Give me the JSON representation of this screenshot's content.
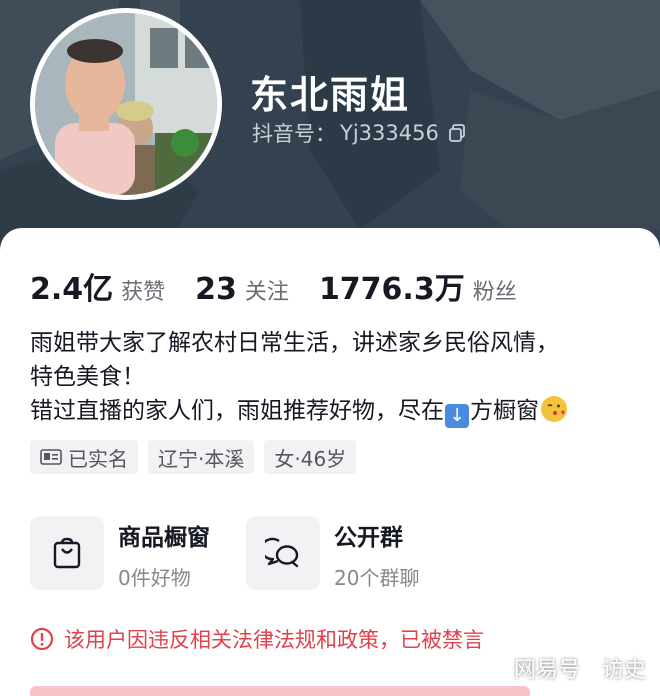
{
  "profile": {
    "nickname": "东北雨姐",
    "id_label": "抖音号：",
    "id_value": "Yj333456"
  },
  "stats": [
    {
      "value": "2.4亿",
      "label": "获赞"
    },
    {
      "value": "23",
      "label": "关注"
    },
    {
      "value": "1776.3万",
      "label": "粉丝"
    }
  ],
  "bio": {
    "line1": "雨姐带大家了解农村日常生活，讲述家乡民俗风情，",
    "line2": "特色美食！",
    "line3_a": "错过直播的家人们，雨姐推荐好物，尽在",
    "line3_b": "方橱窗"
  },
  "tags": [
    {
      "label": "已实名",
      "icon": "id-card-icon"
    },
    {
      "label": "辽宁·本溪"
    },
    {
      "label": "女·46岁"
    }
  ],
  "features": [
    {
      "title": "商品橱窗",
      "subtitle": "0件好物",
      "icon": "shopping-bag-icon"
    },
    {
      "title": "公开群",
      "subtitle": "20个群聊",
      "icon": "chat-bubbles-icon"
    }
  ],
  "notice": {
    "text": "该用户因违反相关法律法规和政策，已被禁言",
    "color": "#e0424c"
  },
  "watermark": {
    "left": "网易号",
    "right": "访史"
  },
  "colors": {
    "banner": "#33414f",
    "card": "#ffffff",
    "tag_bg": "#f2f2f4",
    "danger": "#e0424c"
  }
}
